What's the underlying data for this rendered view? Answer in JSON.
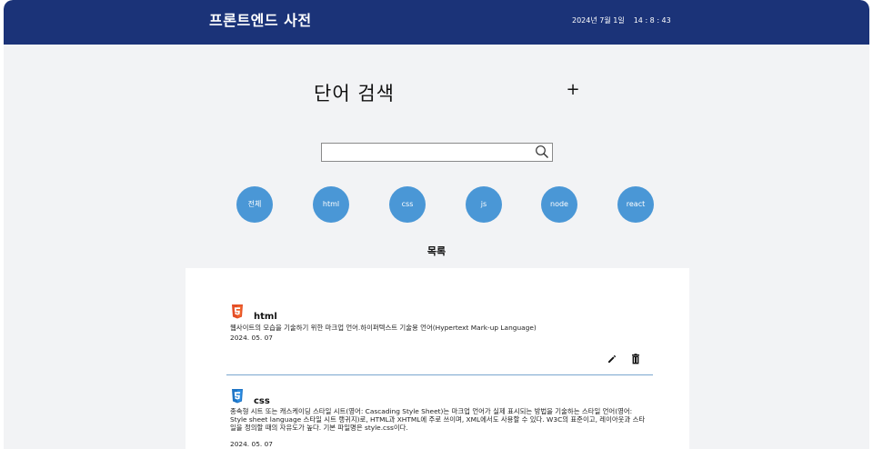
{
  "header": {
    "title": "프론트엔드 사전",
    "date": "2024년 7월 1일",
    "time": "14 : 8 : 43"
  },
  "search": {
    "title": "단어 검색",
    "add_label": "+",
    "value": "",
    "placeholder": ""
  },
  "categories": [
    "전체",
    "html",
    "css",
    "js",
    "node",
    "react"
  ],
  "list": {
    "heading": "목록",
    "entries": [
      {
        "term": "html",
        "icon": "html5-icon",
        "description": "웹사이트의 모습을 기술하기 위한 마크업 언어.하이퍼텍스트 기술용 언어(Hypertext Mark-up Language)",
        "date": "2024. 05. 07"
      },
      {
        "term": "css",
        "icon": "css3-icon",
        "description": "종속형 시트 또는 캐스케이딩 스타일 시트(영어: Cascading Style Sheet)는 마크업 언어가 실제 표시되는 방법을 기술하는 스타일 언어(영어: Style sheet language 스타일 시트 랭귀지)로, HTML과 XHTML에 주로 쓰이며, XML에서도 사용할 수 있다. W3C의 표준이고, 레이아웃과 스타일을 정의할 때의 자유도가 높다. 기본 파일명은 style.css이다.",
        "date": "2024. 05. 07"
      }
    ]
  },
  "colors": {
    "header_bg": "#1b3378",
    "category_bg": "#4a97d6",
    "page_bg": "#f2f3f5",
    "html_badge": "#e44d26",
    "css_badge": "#1e74c5",
    "divider": "#7aa7cf"
  }
}
